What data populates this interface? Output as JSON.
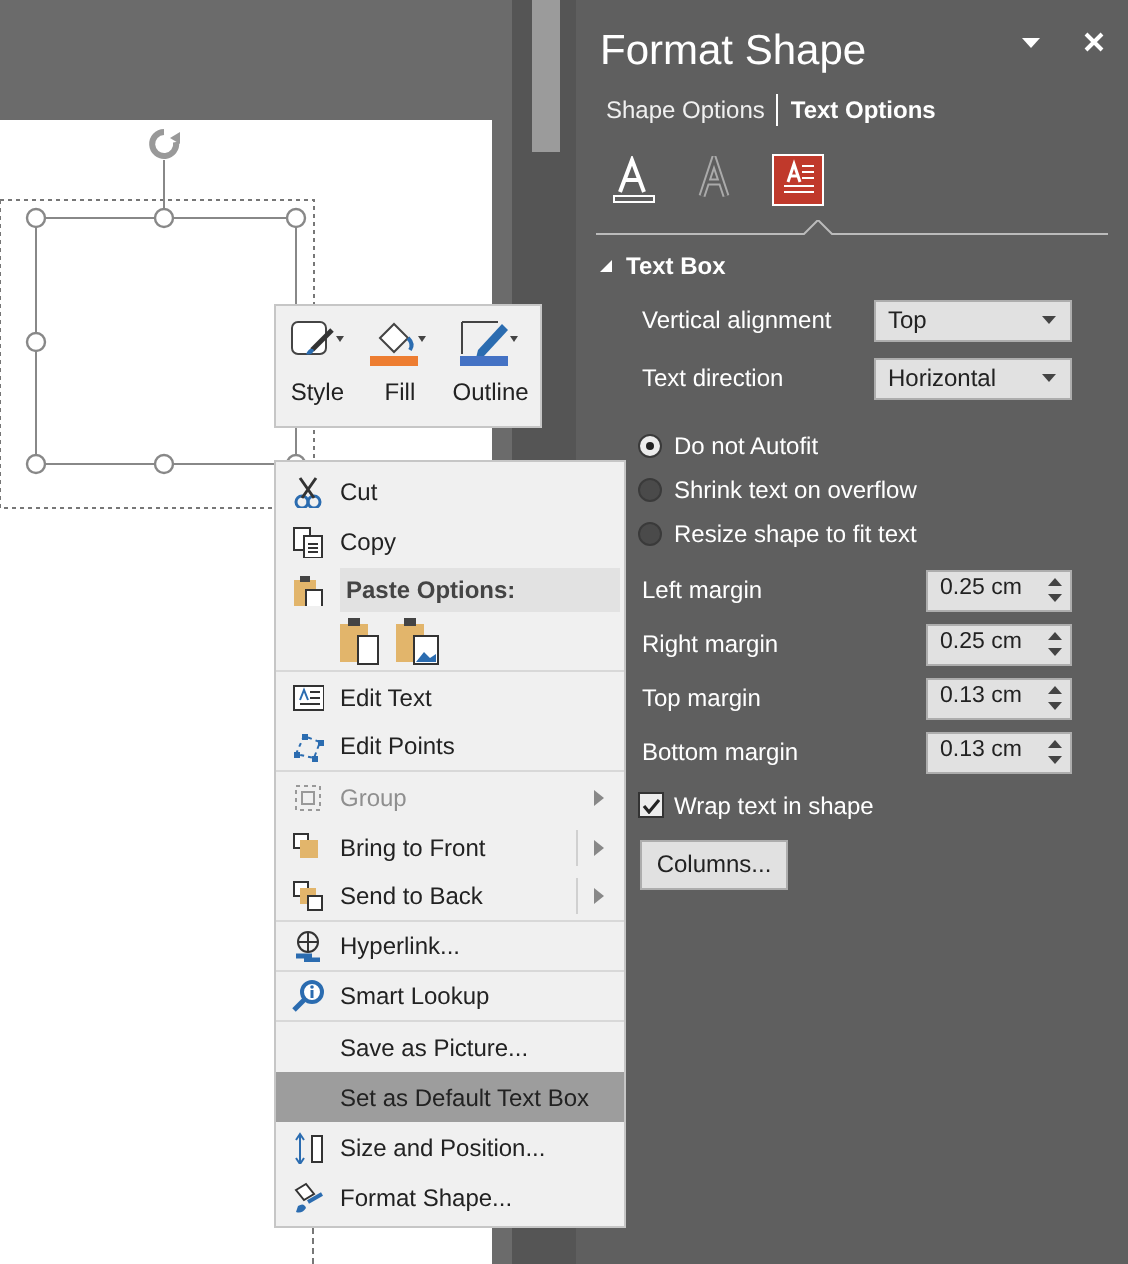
{
  "mini_toolbar": [
    {
      "label": "Style"
    },
    {
      "label": "Fill"
    },
    {
      "label": "Outline"
    }
  ],
  "context_menu": {
    "items": [
      {
        "kind": "item",
        "label": "Cut",
        "disabled": false,
        "selected": false,
        "submenu": false,
        "split": false,
        "divider_after": false
      },
      {
        "kind": "item",
        "label": "Copy",
        "disabled": false,
        "selected": false,
        "submenu": false,
        "split": false,
        "divider_after": false
      },
      {
        "kind": "header",
        "label": "Paste Options:"
      },
      {
        "kind": "paste_icons",
        "divider_after": true
      },
      {
        "kind": "item",
        "label": "Edit Text",
        "disabled": false,
        "selected": false,
        "submenu": false,
        "split": false,
        "divider_after": false
      },
      {
        "kind": "item",
        "label": "Edit Points",
        "disabled": false,
        "selected": false,
        "submenu": false,
        "split": false,
        "divider_after": true
      },
      {
        "kind": "item",
        "label": "Group",
        "disabled": true,
        "selected": false,
        "submenu": true,
        "split": false,
        "divider_after": false
      },
      {
        "kind": "item",
        "label": "Bring to Front",
        "disabled": false,
        "selected": false,
        "submenu": true,
        "split": true,
        "divider_after": false
      },
      {
        "kind": "item",
        "label": "Send to Back",
        "disabled": false,
        "selected": false,
        "submenu": true,
        "split": true,
        "divider_after": true
      },
      {
        "kind": "item",
        "label": "Hyperlink...",
        "disabled": false,
        "selected": false,
        "submenu": false,
        "split": false,
        "divider_after": true
      },
      {
        "kind": "item",
        "label": "Smart Lookup",
        "disabled": false,
        "selected": false,
        "submenu": false,
        "split": false,
        "divider_after": true
      },
      {
        "kind": "item",
        "label": "Save as Picture...",
        "disabled": false,
        "selected": false,
        "submenu": false,
        "split": false,
        "divider_after": false
      },
      {
        "kind": "item",
        "label": "Set as Default Text Box",
        "disabled": false,
        "selected": true,
        "submenu": false,
        "split": false,
        "divider_after": false
      },
      {
        "kind": "item",
        "label": "Size and Position...",
        "disabled": false,
        "selected": false,
        "submenu": false,
        "split": false,
        "divider_after": false
      },
      {
        "kind": "item",
        "label": "Format Shape...",
        "disabled": false,
        "selected": false,
        "submenu": false,
        "split": false,
        "divider_after": false
      }
    ]
  },
  "format_pane": {
    "title": "Format Shape",
    "tabs": [
      {
        "label": "Shape Options",
        "selected": false
      },
      {
        "label": "Text Options",
        "selected": true
      }
    ],
    "icon_tabs": [
      {
        "selected": false
      },
      {
        "selected": false
      },
      {
        "selected": true
      }
    ],
    "section": {
      "title": "Text Box",
      "expanded": true,
      "dropdowns": [
        {
          "label": "Vertical alignment",
          "value": "Top"
        },
        {
          "label": "Text direction",
          "value": "Horizontal"
        }
      ],
      "autofit": [
        {
          "label": "Do not Autofit",
          "selected": true
        },
        {
          "label": "Shrink text on overflow",
          "selected": false
        },
        {
          "label": "Resize shape to fit text",
          "selected": false
        }
      ],
      "margins": [
        {
          "label": "Left margin",
          "value": "0.25 cm"
        },
        {
          "label": "Right margin",
          "value": "0.25 cm"
        },
        {
          "label": "Top margin",
          "value": "0.13 cm"
        },
        {
          "label": "Bottom margin",
          "value": "0.13 cm"
        }
      ],
      "wrap": {
        "label": "Wrap text in shape",
        "checked": true
      },
      "button": "Columns..."
    }
  }
}
